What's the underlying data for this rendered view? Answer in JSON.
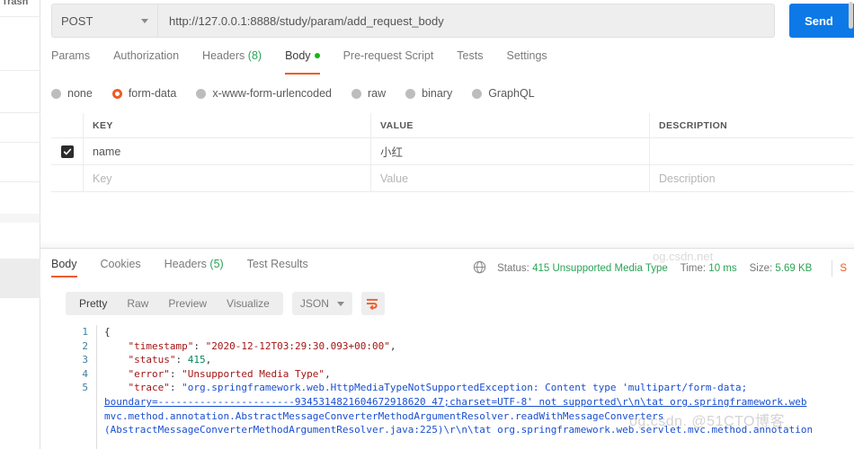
{
  "sidebar": {
    "trash_label": "Trash"
  },
  "request": {
    "method": "POST",
    "url": "http://127.0.0.1:8888/study/param/add_request_body",
    "send_label": "Send",
    "tabs": [
      {
        "label": "Params",
        "active": false,
        "count": ""
      },
      {
        "label": "Authorization",
        "active": false,
        "count": ""
      },
      {
        "label": "Headers",
        "active": false,
        "count": "(8)"
      },
      {
        "label": "Body",
        "active": true,
        "count": ""
      },
      {
        "label": "Pre-request Script",
        "active": false,
        "count": ""
      },
      {
        "label": "Tests",
        "active": false,
        "count": ""
      },
      {
        "label": "Settings",
        "active": false,
        "count": ""
      }
    ],
    "body_types": [
      {
        "label": "none",
        "selected": false
      },
      {
        "label": "form-data",
        "selected": true
      },
      {
        "label": "x-www-form-urlencoded",
        "selected": false
      },
      {
        "label": "raw",
        "selected": false
      },
      {
        "label": "binary",
        "selected": false
      },
      {
        "label": "GraphQL",
        "selected": false
      }
    ],
    "table": {
      "headers": [
        "KEY",
        "VALUE",
        "DESCRIPTION"
      ],
      "rows": [
        {
          "checked": true,
          "key": "name",
          "value": "小红",
          "description": ""
        }
      ],
      "placeholder_row": {
        "key": "Key",
        "value": "Value",
        "description": "Description"
      }
    }
  },
  "response": {
    "tabs": [
      {
        "label": "Body",
        "active": true,
        "count": ""
      },
      {
        "label": "Cookies",
        "active": false,
        "count": ""
      },
      {
        "label": "Headers",
        "active": false,
        "count": "(5)"
      },
      {
        "label": "Test Results",
        "active": false,
        "count": ""
      }
    ],
    "status_label": "Status:",
    "status_value": "415 Unsupported Media Type",
    "time_label": "Time:",
    "time_value": "10 ms",
    "size_label": "Size:",
    "size_value": "5.69 KB",
    "save_response": "S",
    "view_modes": [
      {
        "label": "Pretty",
        "active": true
      },
      {
        "label": "Raw",
        "active": false
      },
      {
        "label": "Preview",
        "active": false
      },
      {
        "label": "Visualize",
        "active": false
      }
    ],
    "format": "JSON",
    "line_numbers": [
      "1",
      "2",
      "3",
      "4",
      "5"
    ],
    "json": {
      "open_brace": "{",
      "timestamp_key": "\"timestamp\"",
      "timestamp_value": "\"2020-12-12T03:29:30.093+00:00\"",
      "status_key": "\"status\"",
      "status_value": "415",
      "error_key": "\"error\"",
      "error_value": "\"Unsupported Media Type\"",
      "trace_key": "\"trace\"",
      "trace_line1": "\"org.springframework.web.HttpMediaTypeNotSupportedException: Content type 'multipart/form-data;",
      "trace_line2": "boundary=-----------------------9345314821604672918620 47;charset=UTF-8' not supported\\r\\n\\tat org.springframework.web",
      "trace_line3": "mvc.method.annotation.AbstractMessageConverterMethodArgumentResolver.readWithMessageConverters",
      "trace_line4": "(AbstractMessageConverterMethodArgumentResolver.java:225)\\r\\n\\tat org.springframework.web.servlet.mvc.method.annotation"
    }
  },
  "watermark": {
    "text": "og.csdn. @51CTO博客",
    "text2": "og.csdn.net"
  },
  "colors": {
    "accent_orange": "#ef5b25",
    "send_blue": "#0c79e6",
    "status_green": "#2aa355",
    "body_dot_green": "#12b912"
  }
}
